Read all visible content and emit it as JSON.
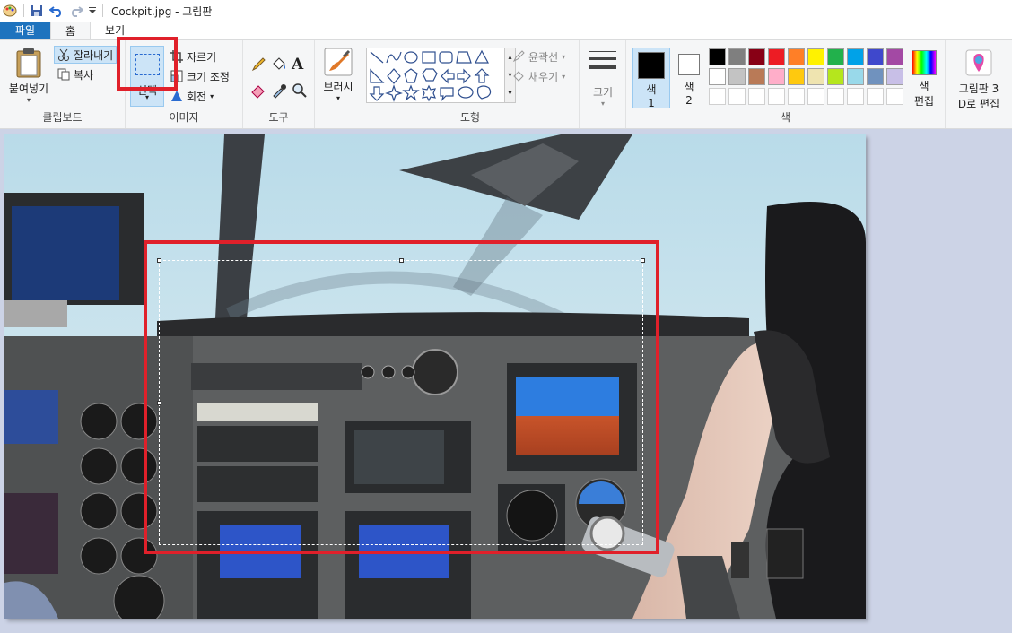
{
  "window": {
    "title": "Cockpit.jpg - 그림판"
  },
  "tabs": [
    "파일",
    "홈",
    "보기"
  ],
  "clipboard": {
    "paste": "붙여넣기",
    "cut": "잘라내기",
    "copy": "복사",
    "group": "클립보드"
  },
  "image": {
    "select": "선택",
    "crop": "자르기",
    "resize": "크기 조정",
    "rotate": "회전",
    "group": "이미지"
  },
  "tools": {
    "group": "도구"
  },
  "brushes": {
    "label": "브러시"
  },
  "shapes": {
    "outline": "윤곽선",
    "fill": "채우기",
    "group": "도형"
  },
  "size": {
    "label": "크기"
  },
  "colors": {
    "color1": "색\n1",
    "color1_line1": "색",
    "color1_line2": "1",
    "color2_line1": "색",
    "color2_line2": "2",
    "edit_line1": "색",
    "edit_line2": "편집",
    "group": "색",
    "palette_row1": [
      "#000000",
      "#7f7f7f",
      "#880015",
      "#ed1c24",
      "#ff7f27",
      "#fff200",
      "#22b14c",
      "#00a2e8",
      "#3f48cc",
      "#a349a4"
    ],
    "palette_row2": [
      "#ffffff",
      "#c3c3c3",
      "#b97a57",
      "#ffaec9",
      "#ffc90e",
      "#efe4b0",
      "#b5e61d",
      "#99d9ea",
      "#7092be",
      "#c8bfe7"
    ],
    "palette_row3": [
      "#ffffff",
      "#ffffff",
      "#ffffff",
      "#ffffff",
      "#ffffff",
      "#ffffff",
      "#ffffff",
      "#ffffff",
      "#ffffff",
      "#ffffff"
    ]
  },
  "paint3d": {
    "line1": "그림판 3",
    "line2": "D로 편집"
  }
}
